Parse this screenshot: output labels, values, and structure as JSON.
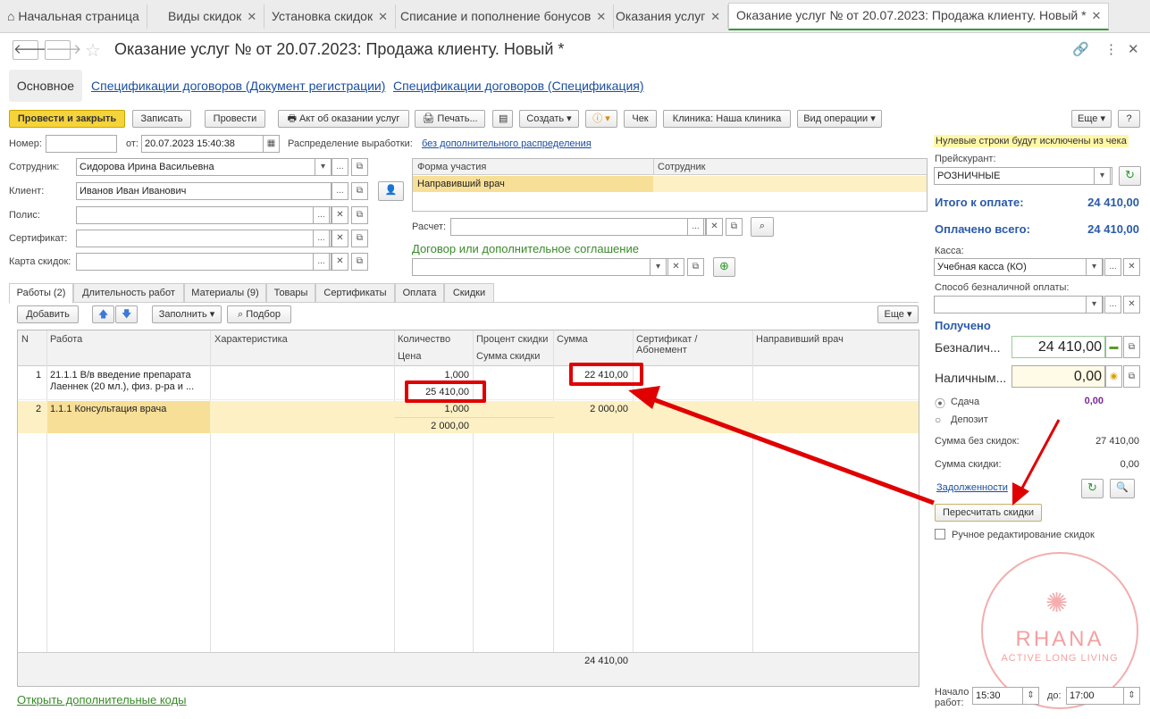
{
  "tabs": [
    "Начальная страница",
    "Виды скидок",
    "Установка скидок",
    "Списание и пополнение бонусов",
    "Оказания услуг",
    "Оказание услуг №  от 20.07.2023: Продажа клиенту.  Новый *"
  ],
  "title": "Оказание услуг №  от 20.07.2023: Продажа клиенту.  Новый *",
  "subtabs": [
    "Основное",
    "Спецификации договоров (Документ регистрации)",
    "Спецификации договоров (Спецификация)"
  ],
  "toolbar": {
    "post_close": "Провести и закрыть",
    "write": "Записать",
    "post": "Провести",
    "act": "Акт об оказании услуг",
    "print": "Печать...",
    "create": "Создать",
    "check": "Чек",
    "clinic": "Клиника: Наша клиника",
    "op_type": "Вид операции",
    "more": "Еще",
    "help": "?"
  },
  "form": {
    "number_label": "Номер:",
    "number_value": "",
    "from_label": "от:",
    "date_value": "20.07.2023 15:40:38",
    "distribution_label": "Распределение выработки:",
    "distribution_value": "без дополнительного распределения",
    "employee_label": "Сотрудник:",
    "employee_value": "Сидорова Ирина Васильевна",
    "client_label": "Клиент:",
    "client_value": "Иванов Иван Иванович",
    "policy_label": "Полис:",
    "certificate_label": "Сертификат:",
    "card_label": "Карта скидок:",
    "calc_label": "Расчет:",
    "contract_label": "Договор или дополнительное соглашение"
  },
  "participation": {
    "headers": [
      "Форма участия",
      "Сотрудник"
    ],
    "row": "Направивший врач"
  },
  "worktabs": [
    "Работы (2)",
    "Длительность работ",
    "Материалы (9)",
    "Товары",
    "Сертификаты",
    "Оплата",
    "Скидки"
  ],
  "gridtoolbar": {
    "add": "Добавить",
    "fill": "Заполнить",
    "pick": "Подбор",
    "more": "Еще"
  },
  "grid": {
    "headers": {
      "n": "N",
      "work": "Работа",
      "char": "Характеристика",
      "qty": "Количество",
      "price": "Цена",
      "disc": "Процент скидки",
      "disc_sum": "Сумма скидки",
      "sum": "Сумма",
      "cert": "Сертификат / Абонемент",
      "doctor": "Направивший врач"
    },
    "rows": [
      {
        "n": "1",
        "work1": "21.1.1 В/в введение препарата",
        "work2": "Лаеннек (20 мл.), физ. р-ра  и ...",
        "qty": "1,000",
        "price": "25 410,00",
        "sum": "22 410,00"
      },
      {
        "n": "2",
        "work1": "1.1.1 Консультация врача",
        "work2": "",
        "qty": "1,000",
        "price": "2 000,00",
        "sum": "2 000,00"
      }
    ],
    "total": "24 410,00"
  },
  "open_codes": "Открыть дополнительные коды",
  "right": {
    "notice": "Нулевые строки будут исключены из чека",
    "pricelist_label": "Прейскурант:",
    "pricelist_value": "РОЗНИЧНЫЕ",
    "total_label": "Итого к оплате:",
    "total_value": "24 410,00",
    "paid_label": "Оплачено всего:",
    "paid_value": "24 410,00",
    "cash_label": "Касса:",
    "cash_value": "Учебная касса (КО)",
    "noncash_label": "Способ безналичной оплаты:",
    "received": "Получено",
    "noncash_short": "Безналич...",
    "noncash_amount": "24 410,00",
    "cash_short": "Наличным...",
    "cash_amount": "0,00",
    "change": "Сдача",
    "change_value": "0,00",
    "deposit": "Депозит",
    "sum_no_disc_label": "Сумма без скидок:",
    "sum_no_disc": "27 410,00",
    "disc_sum_label": "Сумма скидки:",
    "disc_sum": "0,00",
    "debts": "Задолженности",
    "recalc": "Пересчитать скидки",
    "manual": "Ручное редактирование скидок",
    "start_label": "Начало работ:",
    "start": "15:30",
    "to_label": "до:",
    "end": "17:00"
  },
  "watermark": {
    "name": "RHANA",
    "tagline": "ACTIVE LONG LIVING"
  }
}
